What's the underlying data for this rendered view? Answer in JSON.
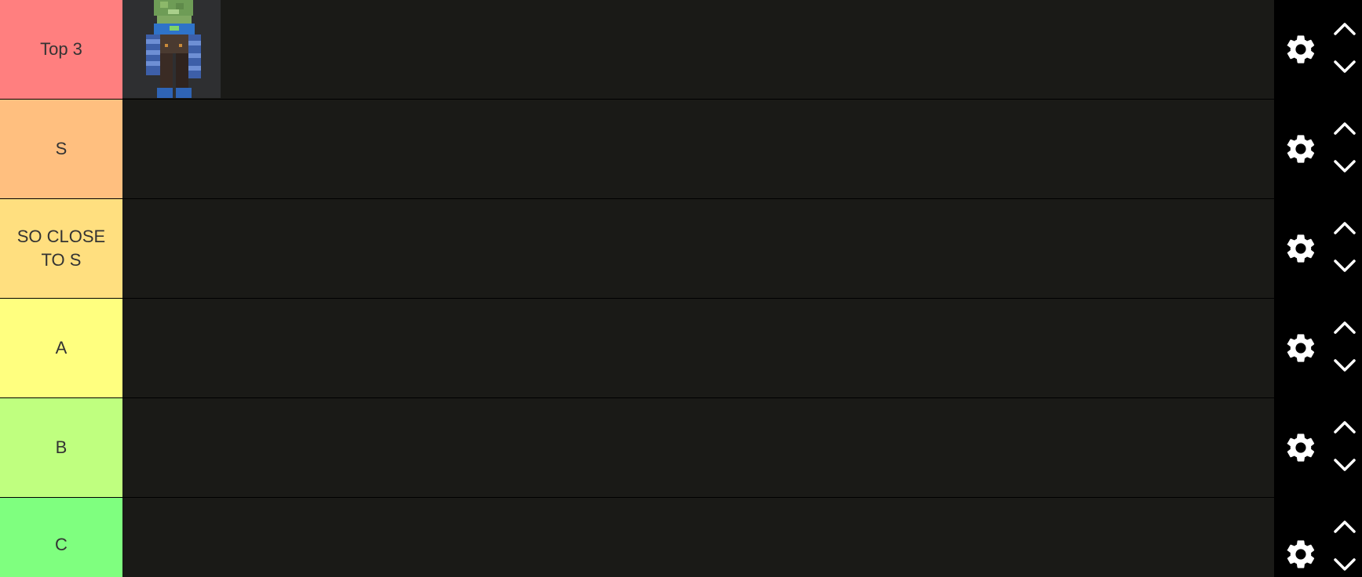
{
  "tiers": [
    {
      "label": "Top 3",
      "color": "#ff7f7f",
      "items": [
        "minecraft-zombie-skin"
      ]
    },
    {
      "label": "S",
      "color": "#ffbf7f",
      "items": []
    },
    {
      "label": "SO CLOSE TO S",
      "color": "#ffdf7f",
      "items": []
    },
    {
      "label": "A",
      "color": "#ffff7f",
      "items": []
    },
    {
      "label": "B",
      "color": "#bfff7f",
      "items": []
    },
    {
      "label": "C",
      "color": "#7fff7f",
      "items": []
    }
  ],
  "colors": {
    "row_background": "#1a1a17",
    "controls_background": "#000000",
    "icon_color": "#ffffff",
    "label_text": "#333333"
  },
  "icons": {
    "settings": "gear-icon",
    "move_up": "chevron-up-icon",
    "move_down": "chevron-down-icon"
  }
}
